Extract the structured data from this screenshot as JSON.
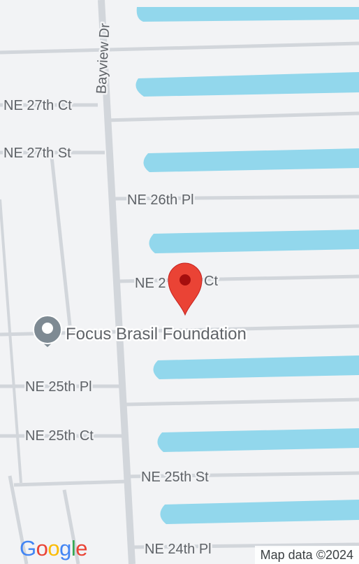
{
  "map": {
    "colors": {
      "land": "#f2f3f5",
      "road": "#d2d6db",
      "water": "#92d7ec",
      "pin": "#ea4335",
      "pin_dark": "#a50e0e",
      "poi": "#7e8a93"
    },
    "streets": {
      "bayview": "Bayview Dr",
      "ne_27th_ct": "NE 27th Ct",
      "ne_27th_st": "NE 27th St",
      "ne_26th_pl": "NE 26th Pl",
      "ne_26th_ct_pre": "NE 2",
      "ne_26th_ct_post": "Ct",
      "ne_25th_pl": "NE 25th Pl",
      "ne_25th_ct": "NE 25th Ct",
      "ne_25th_st": "NE 25th St",
      "ne_24th_pl": "NE 24th Pl"
    },
    "poi": {
      "name": "Focus Brasil Foundation",
      "icon": "place-marker-icon"
    },
    "pin": {
      "icon": "location-pin-icon"
    },
    "logo": {
      "letters": [
        "G",
        "o",
        "o",
        "g",
        "l",
        "e"
      ],
      "colors": [
        "#4285f4",
        "#ea4335",
        "#fbbc05",
        "#4285f4",
        "#34a853",
        "#ea4335"
      ]
    },
    "attribution": "Map data ©2024"
  }
}
